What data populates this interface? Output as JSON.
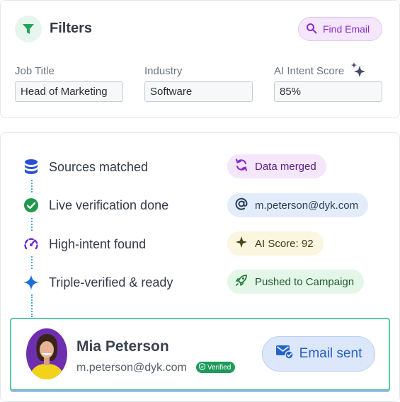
{
  "filters": {
    "title": "Filters",
    "find_email_label": "Find Email",
    "fields": [
      {
        "label": "Job Title",
        "value": "Head of Marketing"
      },
      {
        "label": "Industry",
        "value": "Software"
      },
      {
        "label": "AI Intent Score",
        "value": "85%"
      }
    ]
  },
  "steps": [
    {
      "label": "Sources matched",
      "icon": "database-icon",
      "pill": "Data merged",
      "pill_icon": "refresh-icon"
    },
    {
      "label": "Live verification done",
      "icon": "check-circle-icon",
      "pill": "m.peterson@dyk.com",
      "pill_icon": "at-sign-icon"
    },
    {
      "label": "High-intent found",
      "icon": "gauge-icon",
      "pill": "AI Score: 92",
      "pill_icon": "sparkle-icon"
    },
    {
      "label": "Triple-verified & ready",
      "icon": "diamond-star-icon",
      "pill": "Pushed to Campaign",
      "pill_icon": "rocket-icon"
    }
  ],
  "contact": {
    "name": "Mia Peterson",
    "email": "m.peterson@dyk.com",
    "badge": "Verified",
    "status_button": "Email sent"
  },
  "colors": {
    "accent_green": "#1f9a5a",
    "accent_purple": "#8a2bd0",
    "accent_blue": "#2462c9",
    "connector": "#45a9d8"
  }
}
